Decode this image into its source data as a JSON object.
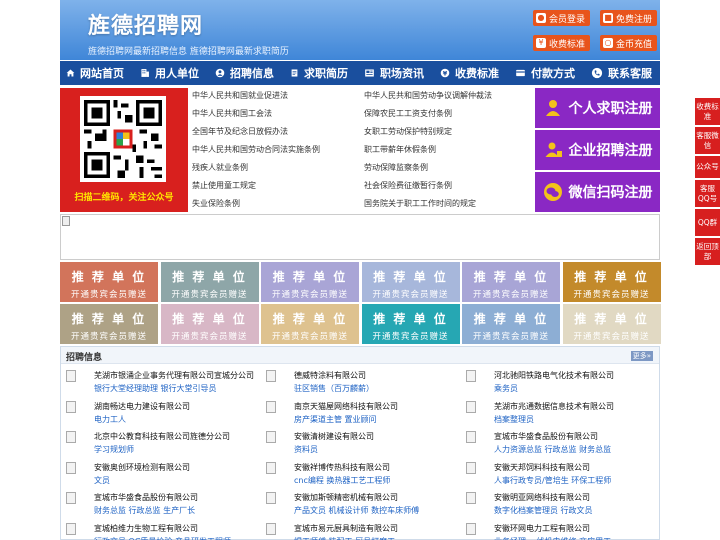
{
  "header": {
    "logo": "旌德招聘网",
    "slogan": "旌德招聘网最新招聘信息  旌德招聘网最新求职简历",
    "buttons": [
      {
        "icon": "user-icon",
        "label": "会员登录"
      },
      {
        "icon": "gift-icon",
        "label": "免费注册"
      },
      {
        "icon": "yen-icon",
        "label": "收费标准"
      },
      {
        "icon": "coin-icon",
        "label": "金币充值"
      }
    ]
  },
  "nav": [
    {
      "icon": "home-icon",
      "label": "网站首页"
    },
    {
      "icon": "building-icon",
      "label": "用人单位"
    },
    {
      "icon": "recruit-icon",
      "label": "招聘信息"
    },
    {
      "icon": "resume-icon",
      "label": "求职简历"
    },
    {
      "icon": "news-icon",
      "label": "职场资讯"
    },
    {
      "icon": "money-icon",
      "label": "收费标准"
    },
    {
      "icon": "payment-icon",
      "label": "付款方式"
    },
    {
      "icon": "phone-icon",
      "label": "联系客服"
    }
  ],
  "qr": {
    "caption": "扫描二维码，关注公众号"
  },
  "links_left": [
    "中华人民共和国就业促进法",
    "中华人民共和国工会法",
    "全国年节及纪念日放假办法",
    "中华人民共和国劳动合同法实施条例",
    "残疾人就业条例",
    "禁止使用童工规定",
    "失业保险条例"
  ],
  "links_right": [
    "中华人民共和国劳动争议调解仲裁法",
    "保障农民工工资支付条例",
    "女职工劳动保护特别规定",
    "职工带薪年休假条例",
    "劳动保障监察条例",
    "社会保险费征缴暂行条例",
    "国务院关于职工工作时间的规定"
  ],
  "register": [
    {
      "icon": "person-icon",
      "label": "个人求职注册"
    },
    {
      "icon": "company-icon",
      "label": "企业招聘注册"
    },
    {
      "icon": "wechat-icon",
      "label": "微信扫码注册"
    }
  ],
  "recommend": {
    "title": "推 荐 单 位",
    "subtitle": "开通贵宾会员赠送",
    "colors": [
      "#d2745b",
      "#8ea6a8",
      "#a9a5d6",
      "#a7b7db",
      "#a8a5d6",
      "#c38a2b",
      "#aea286",
      "#d8b7c6",
      "#dec28f",
      "#26a7b3",
      "#8daed4",
      "#e1d9c3"
    ]
  },
  "recruit": {
    "title": "招聘信息",
    "more": "更多»",
    "jobs": [
      {
        "company": "芜湖市银涌企业事务代理有限公司宣城分公司",
        "positions": "银行大堂经理助理 银行大堂引导员"
      },
      {
        "company": "德威特涂料有限公司",
        "positions": "驻区销售（百万麟薪）"
      },
      {
        "company": "河北驰阳铁路电气化技术有限公司",
        "positions": "乘务员"
      },
      {
        "company": "湖南畅达电力建设有限公司",
        "positions": "电力工人"
      },
      {
        "company": "南京天猫屋网络科技有限公司",
        "positions": "房产渠道主管 置业顾问"
      },
      {
        "company": "芜湖市兆通数据信息技术有限公司",
        "positions": "档案整理员"
      },
      {
        "company": "北京中公教育科技有限公司旌德分公司",
        "positions": "学习规划师"
      },
      {
        "company": "安徽清树建设有限公司",
        "positions": "资料员"
      },
      {
        "company": "宣城市华盛食品股份有限公司",
        "positions": "人力资源总监 行政总监 财务总监"
      },
      {
        "company": "安徽奥创环境检测有限公司",
        "positions": "文员"
      },
      {
        "company": "安徽祥博传热科技有限公司",
        "positions": "cnc编程 换热器工艺工程师"
      },
      {
        "company": "安徽天邦饲料科技有限公司",
        "positions": "人事行政专员/管培生 环保工程师"
      },
      {
        "company": "宣城市华盛食品股份有限公司",
        "positions": "财务总监 行政总监 生产厂长"
      },
      {
        "company": "安徽加斯顿精密机械有限公司",
        "positions": "产品文员 机械设计师 数控车床师傅"
      },
      {
        "company": "安徽明亚网络科技有限公司",
        "positions": "数字化档案管理员 行政文员"
      },
      {
        "company": "宣城柏维力生物工程有限公司",
        "positions": "行政文员 QC质量检验 产品研发工程师"
      },
      {
        "company": "宣城市易元厨具制造有限公司",
        "positions": "焊工师傅 装配工 厨具打磨工"
      },
      {
        "company": "安徽环网电力工程有限公司",
        "positions": "业务经理 一线机电维修 商应用工"
      }
    ]
  },
  "side": [
    "收费标准",
    "客服微信",
    "公众号",
    "客服QQ号",
    "QQ群",
    "返回顶部"
  ]
}
